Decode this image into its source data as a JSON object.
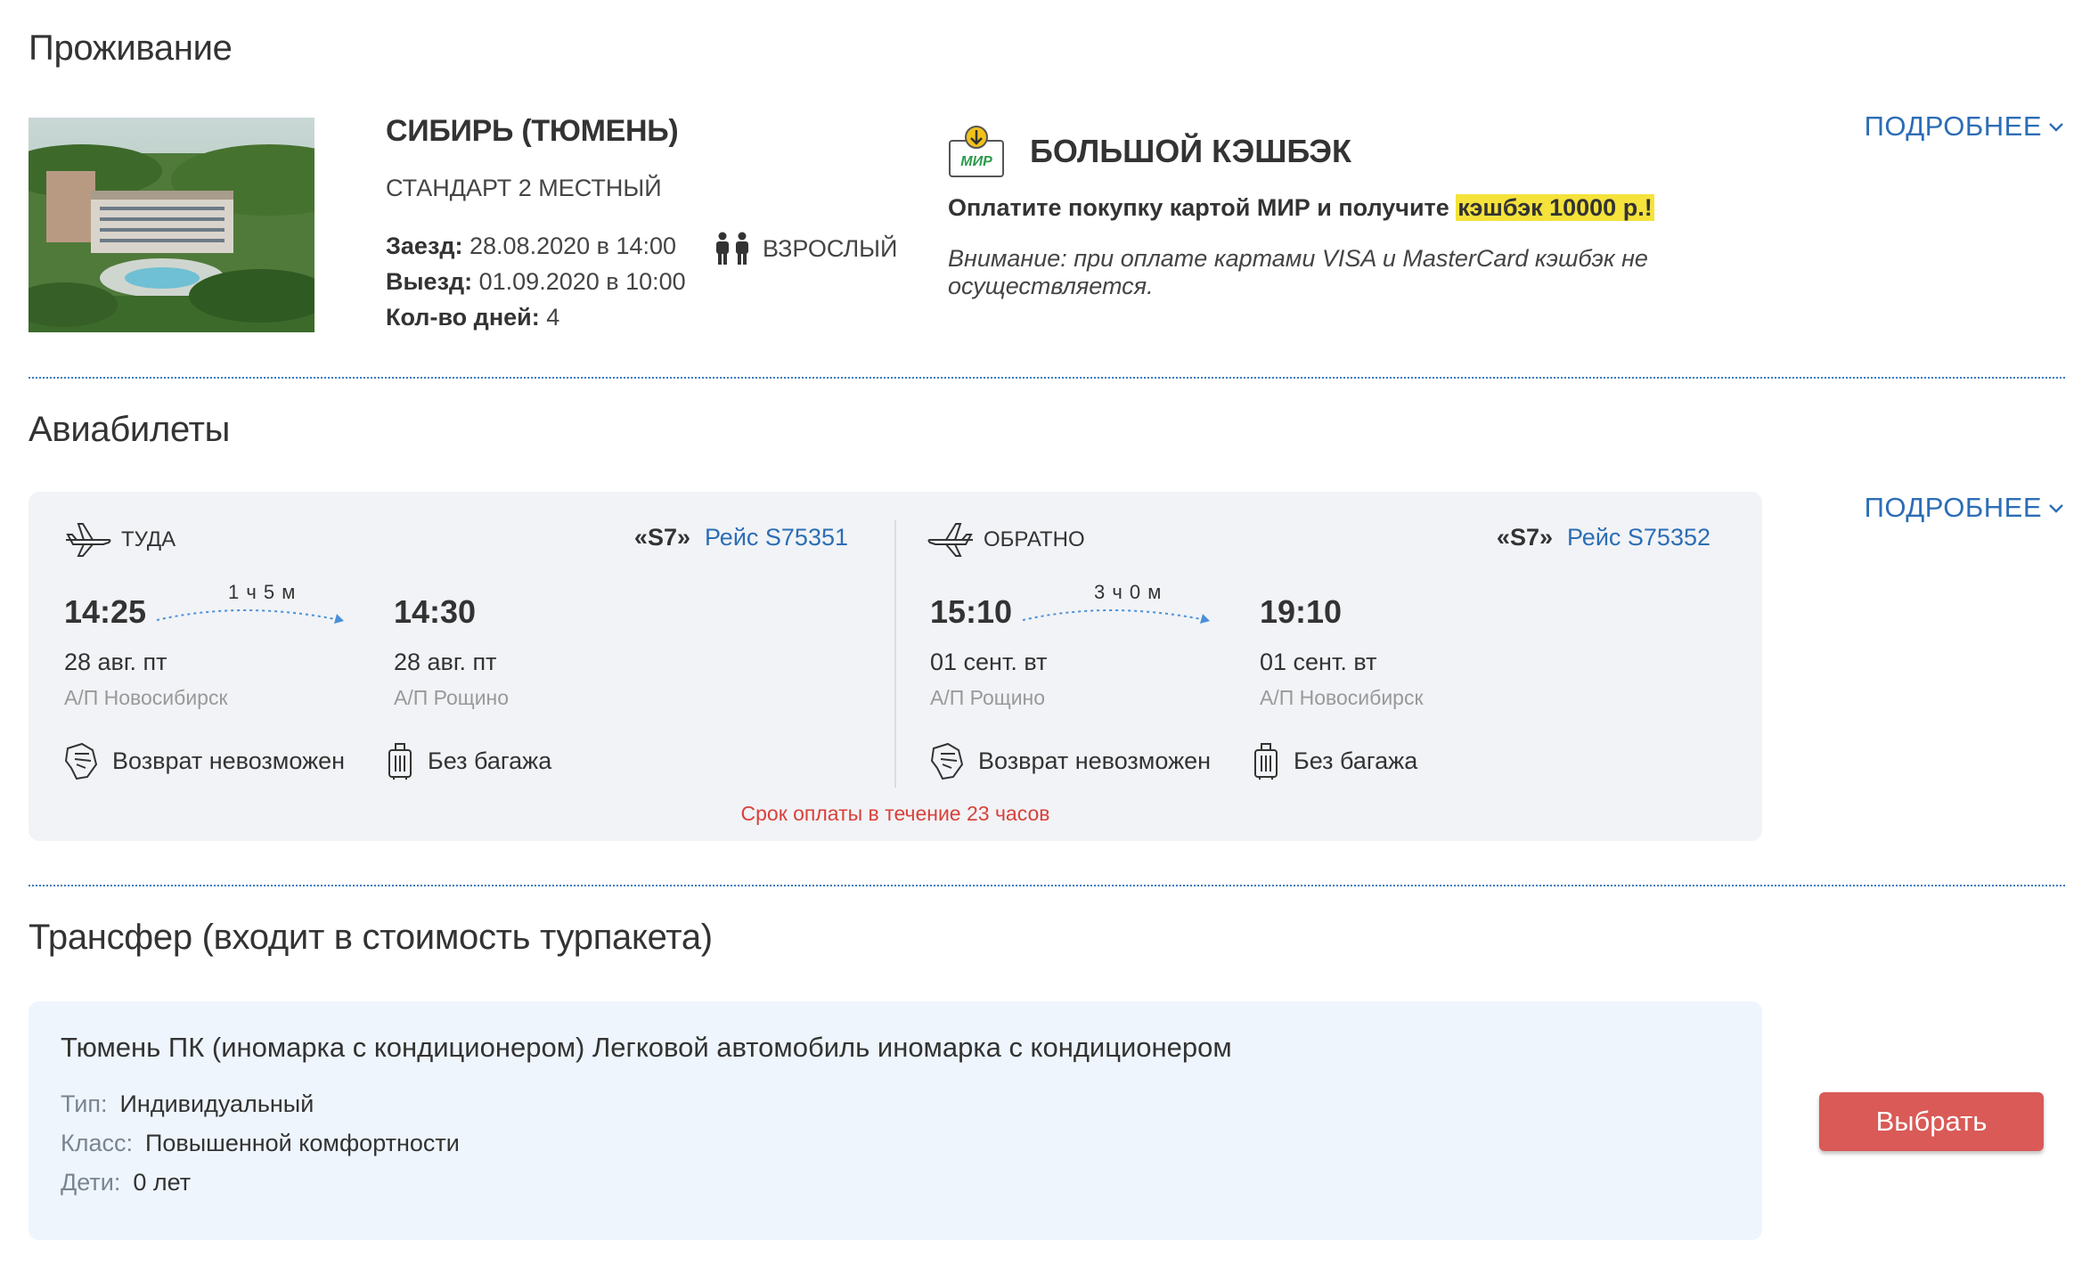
{
  "accommodation": {
    "section_title": "Проживание",
    "more_label": "ПОДРОБНЕЕ",
    "hotel_name": "СИБИРЬ (ТЮМЕНЬ)",
    "room_type": "СТАНДАРТ 2 МЕСТНЫЙ",
    "checkin_label": "Заезд:",
    "checkin_value": " 28.08.2020 в 14:00",
    "checkout_label": "Выезд:",
    "checkout_value": " 01.09.2020 в 10:00",
    "days_label": "Кол-во дней:",
    "days_value": " 4",
    "guests": "ВЗРОСЛЫЙ",
    "cashback": {
      "logo_text": "МИР",
      "title": "БОЛЬШОЙ КЭШБЭК",
      "text": "Оплатите покупку картой МИР и получите ",
      "highlight": "кэшбэк 10000 р.!",
      "note": "Внимание: при оплате картами VISA и MasterCard кэшбэк не осуществляется."
    }
  },
  "flights": {
    "section_title": "Авиабилеты",
    "more_label": "ПОДРОБНЕЕ",
    "outbound": {
      "direction": "ТУДА",
      "airline": "«S7»",
      "flight": "Рейс S75351",
      "duration": "1 ч 5 м",
      "dep_time": "14:25",
      "dep_date": "28 авг. пт",
      "dep_airport": "А/П Новосибирск",
      "arr_time": "14:30",
      "arr_date": "28 авг. пт",
      "arr_airport": "А/П Рощино",
      "refund": "Возврат невозможен",
      "baggage": "Без багажа"
    },
    "return": {
      "direction": "ОБРАТНО",
      "airline": "«S7»",
      "flight": "Рейс S75352",
      "duration": "3 ч 0 м",
      "dep_time": "15:10",
      "dep_date": "01 сент. вт",
      "dep_airport": "А/П Рощино",
      "arr_time": "19:10",
      "arr_date": "01 сент. вт",
      "arr_airport": "А/П Новосибирск",
      "refund": "Возврат невозможен",
      "baggage": "Без багажа"
    },
    "payment_deadline": "Срок оплаты в течение 23 часов"
  },
  "transfer": {
    "section_title": "Трансфер (входит в стоимость турпакета)",
    "title": "Тюмень ПК (иномарка с кондиционером) Легковой автомобиль иномарка с кондиционером",
    "type_label": "Тип:",
    "type_value": "Индивидуальный",
    "class_label": "Класс:",
    "class_value": "Повышенной комфортности",
    "kids_label": "Дети:",
    "kids_value": "0 лет",
    "select_label": "Выбрать"
  },
  "colors": {
    "link": "#2c6db5",
    "accent_red": "#d95a57",
    "deadline": "#d9413b",
    "highlight": "#f5e23b"
  }
}
